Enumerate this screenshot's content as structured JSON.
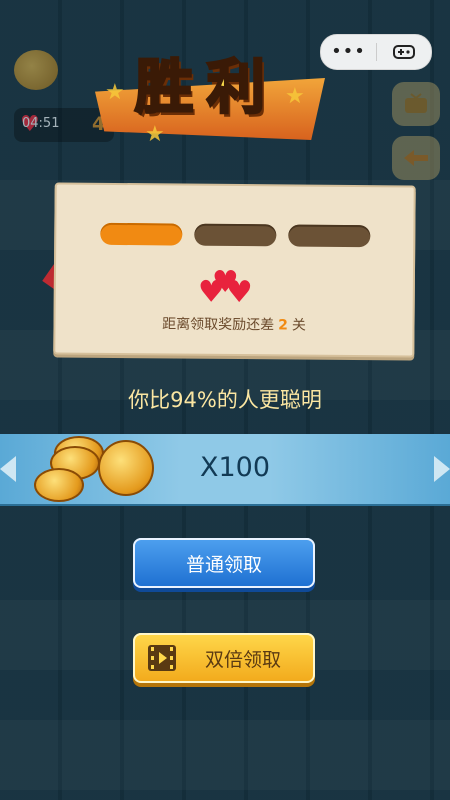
{
  "hud": {
    "timer": "04:51",
    "lives": "4"
  },
  "capsule": {
    "menu_icon": "more-dots-icon",
    "game_icon": "gamepad-icon"
  },
  "banner": {
    "title": "胜利"
  },
  "card": {
    "progress": {
      "total": 3,
      "filled": 1
    },
    "message_prefix": "距离领取奖励还差",
    "message_count": "2",
    "message_suffix": "关"
  },
  "compare_text": "你比94%的人更聪明",
  "reward": {
    "amount": "X100"
  },
  "buttons": {
    "normal": "普通领取",
    "double": "双倍领取"
  },
  "colors": {
    "accent_orange": "#f18a12",
    "blue_button": "#1d6fd1",
    "gold_button": "#f2a91b",
    "compare_text": "#fbe6a2"
  }
}
